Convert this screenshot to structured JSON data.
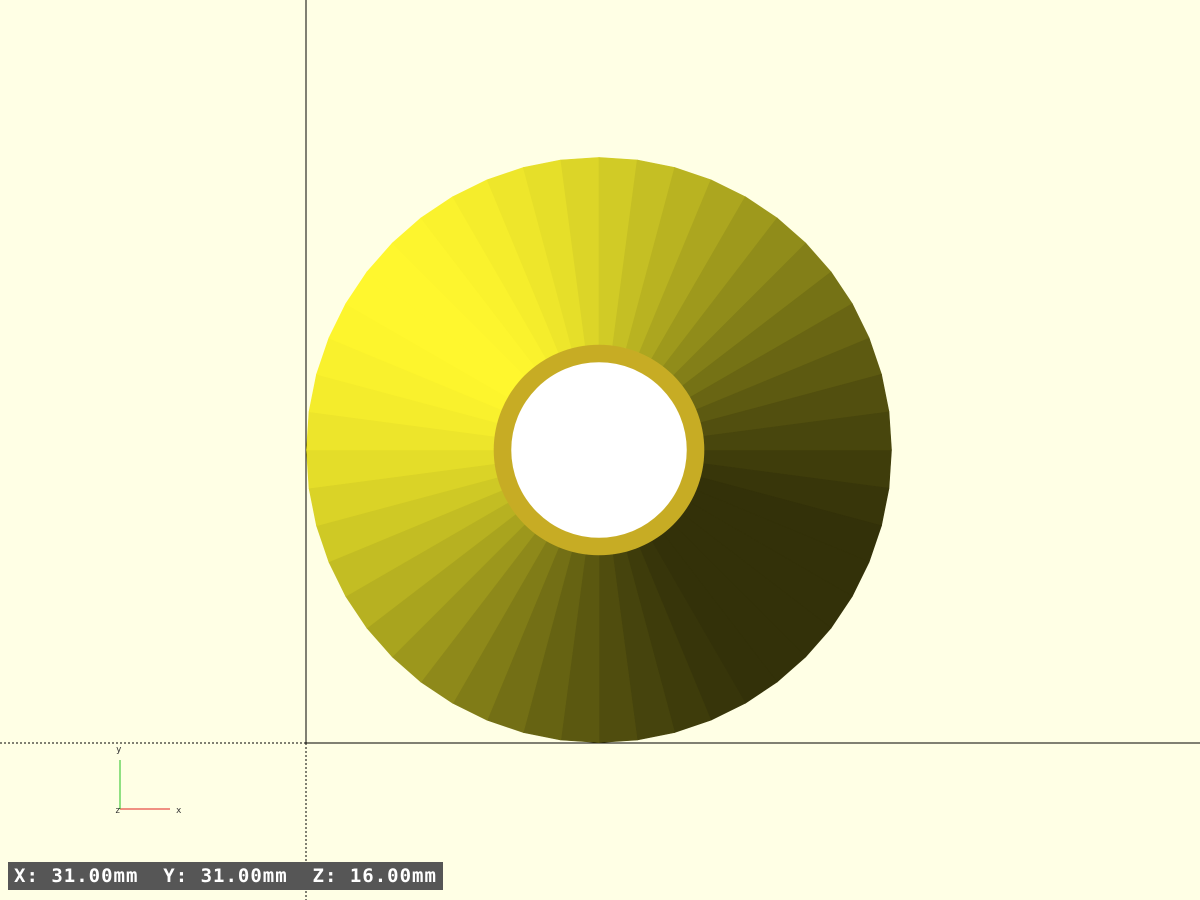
{
  "viewport": {
    "background": "#ffffe5",
    "model_color": "#fff733",
    "hole_rim_color": "#c7ac24",
    "model": {
      "name": "washer",
      "outer_diameter": 20,
      "inner_diameter": 6,
      "rim_diameter": 7.2,
      "center_offset": [
        0,
        10
      ],
      "facets": 48
    },
    "light_direction": [
      -0.7,
      0.55,
      0.45
    ]
  },
  "axes": {
    "x_label": "x",
    "y_label": "y",
    "z_label": "z",
    "x_color": "#e02020",
    "y_color": "#20c020",
    "z_color": "#2020e0"
  },
  "status": {
    "coordinates": "X: 31.00mm  Y: 31.00mm  Z: 16.00mm"
  }
}
